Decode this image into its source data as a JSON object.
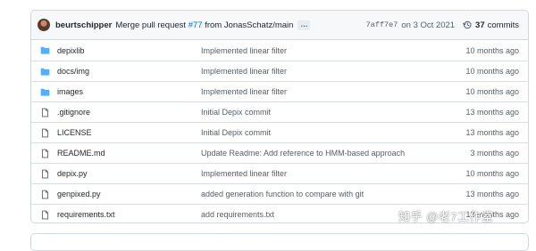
{
  "commit": {
    "author": "beurtschipper",
    "message_prefix": "Merge pull request",
    "pr_link": "#77",
    "message_suffix": "from JonasSchatz/main",
    "expand_label": "…",
    "sha": "7aff7e7",
    "date": "on 3 Oct 2021",
    "commits_count": "37",
    "commits_label": "commits"
  },
  "files": [
    {
      "name": "depixlib",
      "type": "folder",
      "message": "Implemented linear filter",
      "age": "10 months ago"
    },
    {
      "name": "docs/img",
      "type": "folder",
      "message": "Implemented linear filter",
      "age": "10 months ago"
    },
    {
      "name": "images",
      "type": "folder",
      "message": "Implemented linear filter",
      "age": "10 months ago"
    },
    {
      "name": ".gitignore",
      "type": "file",
      "message": "Initial Depix commit",
      "age": "13 months ago"
    },
    {
      "name": "LICENSE",
      "type": "file",
      "message": "Initial Depix commit",
      "age": "13 months ago"
    },
    {
      "name": "README.md",
      "type": "file",
      "message": "Update Readme: Add reference to HMM-based approach",
      "age": "3 months ago"
    },
    {
      "name": "depix.py",
      "type": "file",
      "message": "Implemented linear filter",
      "age": "10 months ago"
    },
    {
      "name": "genpixed.py",
      "type": "file",
      "message": "added generation function to compare with git",
      "age": "13 months ago"
    },
    {
      "name": "requirements.txt",
      "type": "file",
      "message": "add requirements.txt",
      "age": "13 months ago"
    }
  ],
  "icons": {
    "folder": "folder-icon",
    "file": "file-icon",
    "history": "history-icon"
  },
  "colors": {
    "folder": "#54aeff",
    "link": "#0969da",
    "muted": "#57606a"
  },
  "watermark": "知乎 @老7工作室"
}
